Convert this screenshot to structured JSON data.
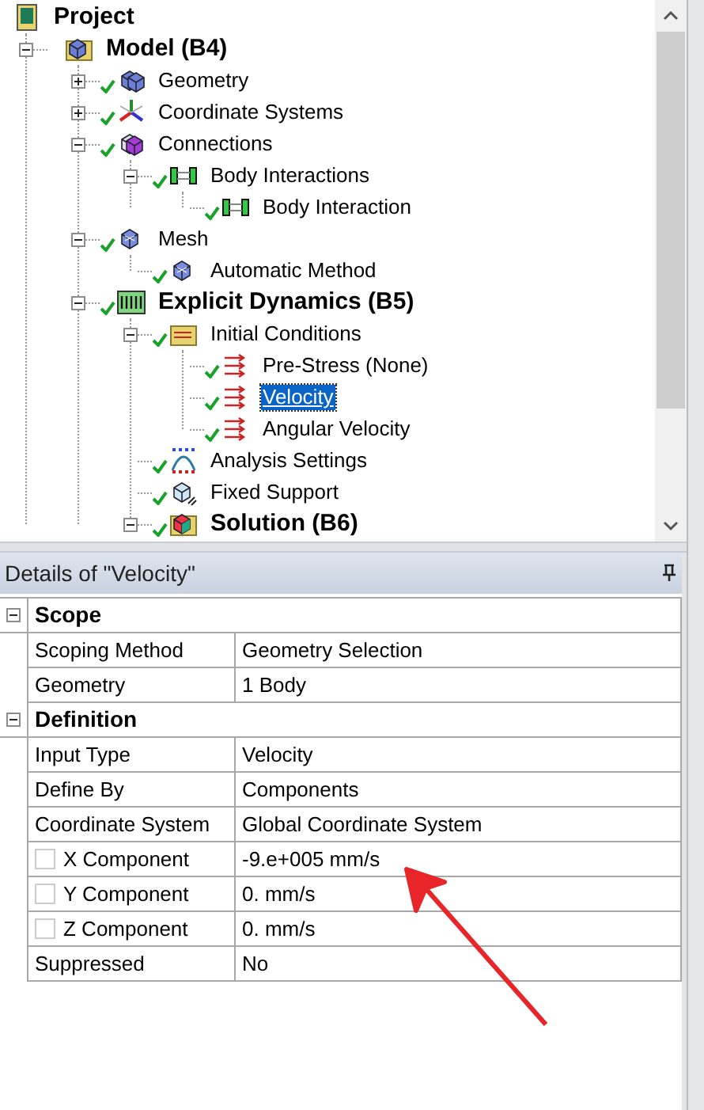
{
  "tree": [
    {
      "label": "Project",
      "kind": "project",
      "bold": true,
      "selected": false,
      "children": [
        {
          "label": "Model (B4)",
          "kind": "model",
          "bold": true,
          "ok": false,
          "selected": false,
          "expanded": true,
          "children": [
            {
              "label": "Geometry",
              "kind": "geometry",
              "bold": false,
              "ok": true,
              "selected": false,
              "expanded": false
            },
            {
              "label": "Coordinate Systems",
              "kind": "axes",
              "bold": false,
              "ok": true,
              "selected": false,
              "expanded": false
            },
            {
              "label": "Connections",
              "kind": "connections",
              "bold": false,
              "ok": true,
              "selected": false,
              "expanded": true,
              "children": [
                {
                  "label": "Body Interactions",
                  "kind": "interaction",
                  "bold": false,
                  "ok": true,
                  "selected": false,
                  "expanded": true,
                  "children": [
                    {
                      "label": "Body Interaction",
                      "kind": "interaction",
                      "bold": false,
                      "ok": true,
                      "selected": false
                    }
                  ]
                }
              ]
            },
            {
              "label": "Mesh",
              "kind": "mesh",
              "bold": false,
              "ok": true,
              "selected": false,
              "expanded": true,
              "children": [
                {
                  "label": "Automatic Method",
                  "kind": "mesh",
                  "bold": false,
                  "ok": true,
                  "selected": false
                }
              ]
            },
            {
              "label": "Explicit Dynamics (B5)",
              "kind": "dyn",
              "bold": true,
              "ok": true,
              "selected": false,
              "expanded": true,
              "children": [
                {
                  "label": "Initial Conditions",
                  "kind": "initial",
                  "bold": false,
                  "ok": true,
                  "selected": false,
                  "expanded": true,
                  "children": [
                    {
                      "label": "Pre-Stress (None)",
                      "kind": "condition",
                      "bold": false,
                      "ok": true,
                      "selected": false
                    },
                    {
                      "label": "Velocity",
                      "kind": "condition",
                      "bold": false,
                      "ok": true,
                      "selected": true
                    },
                    {
                      "label": "Angular Velocity",
                      "kind": "condition",
                      "bold": false,
                      "ok": true,
                      "selected": false
                    }
                  ]
                },
                {
                  "label": "Analysis Settings",
                  "kind": "settings",
                  "bold": false,
                  "ok": true,
                  "selected": false
                },
                {
                  "label": "Fixed Support",
                  "kind": "support",
                  "bold": false,
                  "ok": true,
                  "selected": false
                },
                {
                  "label": "Solution (B6)",
                  "kind": "solution",
                  "bold": true,
                  "ok": true,
                  "selected": false,
                  "expanded": true
                }
              ]
            }
          ]
        }
      ]
    }
  ],
  "details": {
    "title": "Details of \"Velocity\"",
    "groups": [
      {
        "label": "Scope",
        "expanded": true,
        "rows": [
          {
            "kind": "property",
            "name": "Scoping Method",
            "value": "Geometry Selection"
          },
          {
            "kind": "property",
            "name": "Geometry",
            "value": "1 Body"
          }
        ]
      },
      {
        "label": "Definition",
        "expanded": true,
        "rows": [
          {
            "kind": "property",
            "name": "Input Type",
            "value": "Velocity"
          },
          {
            "kind": "property",
            "name": "Define By",
            "value": "Components"
          },
          {
            "kind": "property",
            "name": "Coordinate System",
            "value": "Global Coordinate System"
          },
          {
            "kind": "checkbox",
            "name": "X Component",
            "value": "-9.e+005 mm/s",
            "checked": false
          },
          {
            "kind": "checkbox",
            "name": "Y Component",
            "value": "0. mm/s",
            "checked": false
          },
          {
            "kind": "checkbox",
            "name": "Z Component",
            "value": "0. mm/s",
            "checked": false
          },
          {
            "kind": "property",
            "name": "Suppressed",
            "value": "No"
          }
        ]
      }
    ]
  }
}
